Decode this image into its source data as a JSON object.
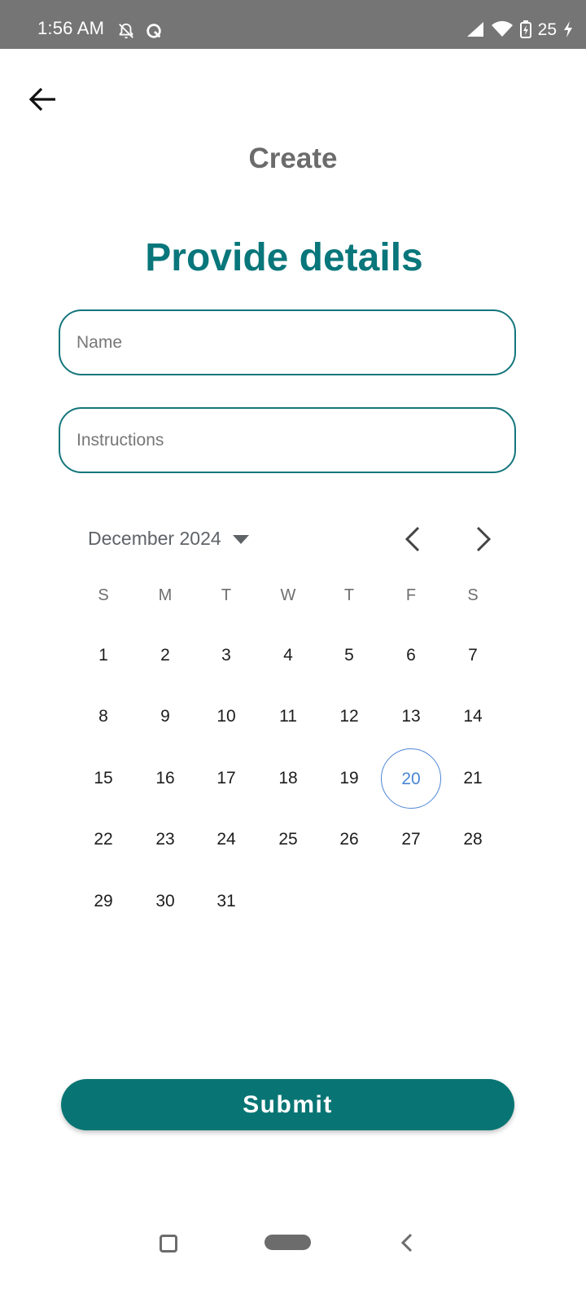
{
  "status_bar": {
    "time": "1:56 AM",
    "battery_level": "25",
    "icons": [
      "notifications-off-icon",
      "q-app-icon",
      "signal-icon",
      "wifi-icon",
      "battery-icon",
      "charging-icon"
    ]
  },
  "header": {
    "back_icon": "arrow-left-icon",
    "title": "Create"
  },
  "form": {
    "heading": "Provide details",
    "name_placeholder": "Name",
    "name_value": "",
    "instructions_placeholder": "Instructions",
    "instructions_value": ""
  },
  "calendar": {
    "month_label": "December 2024",
    "weekdays": [
      "S",
      "M",
      "T",
      "W",
      "T",
      "F",
      "S"
    ],
    "days": [
      "1",
      "2",
      "3",
      "4",
      "5",
      "6",
      "7",
      "8",
      "9",
      "10",
      "11",
      "12",
      "13",
      "14",
      "15",
      "16",
      "17",
      "18",
      "19",
      "20",
      "21",
      "22",
      "23",
      "24",
      "25",
      "26",
      "27",
      "28",
      "29",
      "30",
      "31"
    ],
    "today": "20"
  },
  "submit_label": "Submit",
  "colors": {
    "accent": "#08767a",
    "status_bar": "#757575",
    "today_ring": "#4e86d6"
  }
}
